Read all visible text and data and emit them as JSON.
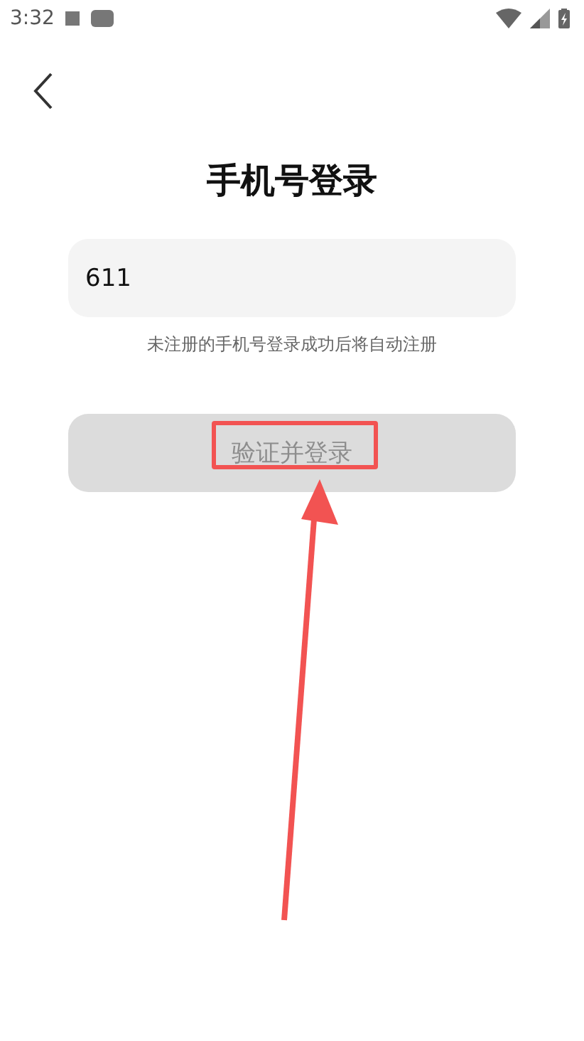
{
  "status_bar": {
    "time": "3:32"
  },
  "title": "手机号登录",
  "phone_field": {
    "value": "611"
  },
  "hint": "未注册的手机号登录成功后将自动注册",
  "login_button": {
    "label": "验证并登录",
    "disabled": true
  },
  "annotation": {
    "highlight": true,
    "arrow": true
  }
}
